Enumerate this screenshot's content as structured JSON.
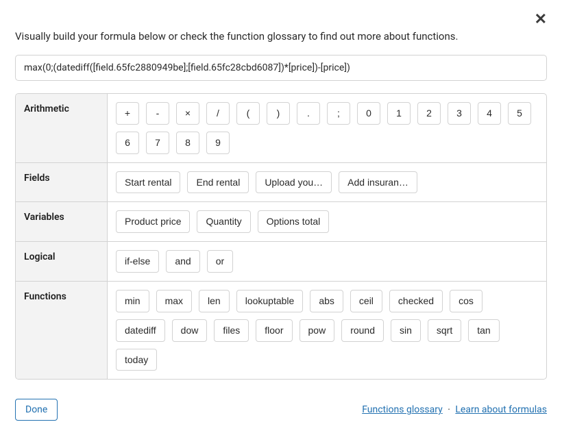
{
  "close": "✕",
  "intro": "Visually build your formula below or check the function glossary to find out more about functions.",
  "formula": "max(0;(datediff([field.65fc2880949be];[field.65fc28cbd6087])*[price])-[price])",
  "sections": {
    "arithmetic": {
      "label": "Arithmetic",
      "tokens": [
        "+",
        "-",
        "×",
        "/",
        "(",
        ")",
        ".",
        ";",
        "0",
        "1",
        "2",
        "3",
        "4",
        "5",
        "6",
        "7",
        "8",
        "9"
      ]
    },
    "fields": {
      "label": "Fields",
      "tokens": [
        "Start rental",
        "End rental",
        "Upload you…",
        "Add insuran…"
      ]
    },
    "variables": {
      "label": "Variables",
      "tokens": [
        "Product price",
        "Quantity",
        "Options total"
      ]
    },
    "logical": {
      "label": "Logical",
      "tokens": [
        "if-else",
        "and",
        "or"
      ]
    },
    "functions": {
      "label": "Functions",
      "tokens": [
        "min",
        "max",
        "len",
        "lookuptable",
        "abs",
        "ceil",
        "checked",
        "cos",
        "datediff",
        "dow",
        "files",
        "floor",
        "pow",
        "round",
        "sin",
        "sqrt",
        "tan",
        "today"
      ]
    }
  },
  "footer": {
    "done": "Done",
    "glossary": "Functions glossary",
    "learn": "Learn about formulas"
  }
}
